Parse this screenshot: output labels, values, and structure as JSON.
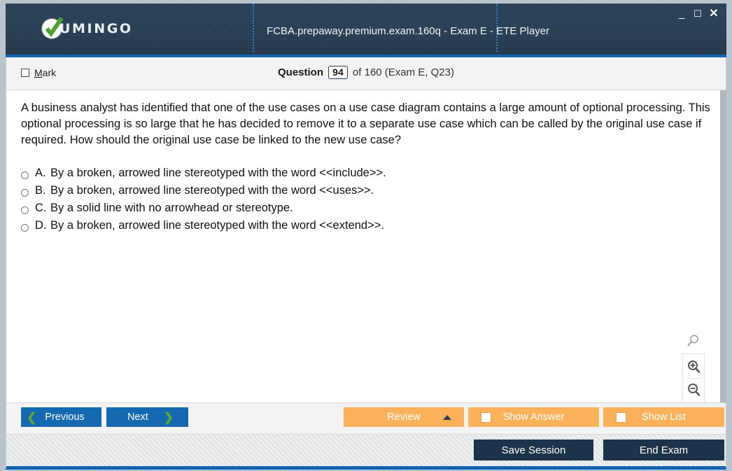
{
  "window": {
    "title": "FCBA.prepaway.premium.exam.160q - Exam E - ETE Player",
    "logo_text": "UMINGO",
    "controls": {
      "minimize": "_",
      "maximize": "☐",
      "close": "✕"
    }
  },
  "header": {
    "mark_label_pre": "",
    "mark_label_u": "M",
    "mark_label_post": "ark",
    "question_word": "Question",
    "question_number": "94",
    "of_text": "of 160 (Exam E, Q23)"
  },
  "question": {
    "text": "A business analyst has identified that one of the use cases on a use case diagram contains a large amount of optional processing. This optional processing is so large that he has decided to remove it to a separate use case which can be called by the original use case if required. How should the original use case be linked to the new use case?",
    "options": [
      {
        "letter": "A.",
        "text": "By a broken, arrowed line stereotyped with the word <<include>>."
      },
      {
        "letter": "B.",
        "text": "By a broken, arrowed line stereotyped with the word <<uses>>."
      },
      {
        "letter": "C.",
        "text": "By a solid line with no arrowhead or stereotype."
      },
      {
        "letter": "D.",
        "text": "By a broken, arrowed line stereotyped with the word <<extend>>."
      }
    ]
  },
  "zoom_tools": {
    "search_icon": "magnifier-icon",
    "zoom_in_icon": "zoom-in-icon",
    "zoom_out_icon": "zoom-out-icon"
  },
  "buttons": {
    "previous": "Previous",
    "next": "Next",
    "review": "Review",
    "show_answer": "Show Answer",
    "show_list": "Show List",
    "save_session": "Save Session",
    "end_exam": "End Exam"
  },
  "colors": {
    "titlebar": "#2b4257",
    "accent_blue": "#1565b5",
    "nav_button": "#1569b0",
    "orange_button": "#fbb159",
    "dark_button": "#1d3349",
    "chevron_green": "#5aa832"
  }
}
